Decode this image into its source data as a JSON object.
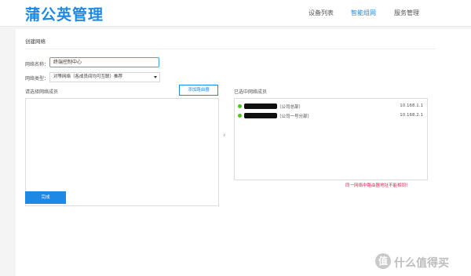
{
  "header": {
    "brand": "蒲公英管理",
    "nav": [
      {
        "label": "设备列表",
        "active": false
      },
      {
        "label": "智能组网",
        "active": true
      },
      {
        "label": "服务管理",
        "active": false
      }
    ]
  },
  "form": {
    "section_title": "创建网络",
    "name_label": "网络名称：",
    "name_value": "终端控制中心",
    "type_label": "网络类型：",
    "type_value": "对等网络（各成员间均可互联）推荐",
    "left_list_title": "请选择网络成员",
    "add_router_label": "添加路由器",
    "right_list_title": "已选中网络成员",
    "members": [
      {
        "name": "（公司总部）",
        "ip": "10.168.1.1",
        "status": "online"
      },
      {
        "name": "（公司一号分部）",
        "ip": "10.168.2.1",
        "status": "online"
      }
    ],
    "arrow": "›",
    "warning": "同一网络中路由器地址不能相同！",
    "done_label": "完成"
  },
  "watermark": {
    "badge": "值",
    "text": "什么值得买"
  },
  "colors": {
    "accent": "#1e88e5",
    "online": "#52c41a",
    "warning": "#e0244f"
  }
}
